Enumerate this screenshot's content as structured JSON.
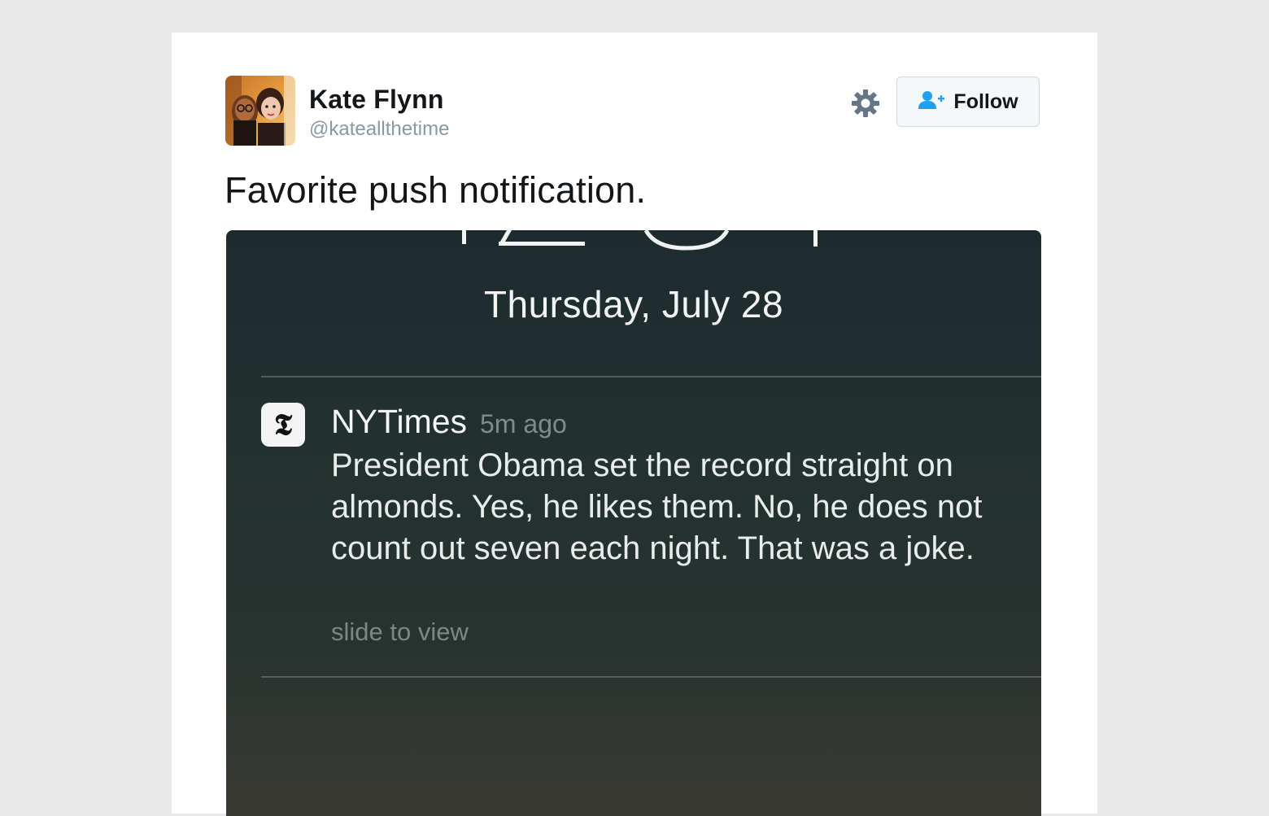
{
  "author": {
    "name": "Kate Flynn",
    "handle": "@kateallthetime"
  },
  "actions": {
    "follow_label": "Follow"
  },
  "tweet": {
    "text": "Favorite push notification."
  },
  "lockscreen": {
    "date": "Thursday, July 28",
    "notification": {
      "app_name": "NYTimes",
      "time": "5m ago",
      "body": "President Obama set the record straight on almonds. Yes, he likes them. No, he does not count out seven each night. That was a joke.",
      "hint": "slide to view",
      "icon_glyph": "𝕿"
    }
  },
  "colors": {
    "follow_icon": "#1da1f2",
    "gear_icon": "#657786"
  },
  "icons": {
    "settings": "gear-icon",
    "follow": "add-user-icon",
    "nytimes": "nytimes-logo-icon"
  }
}
